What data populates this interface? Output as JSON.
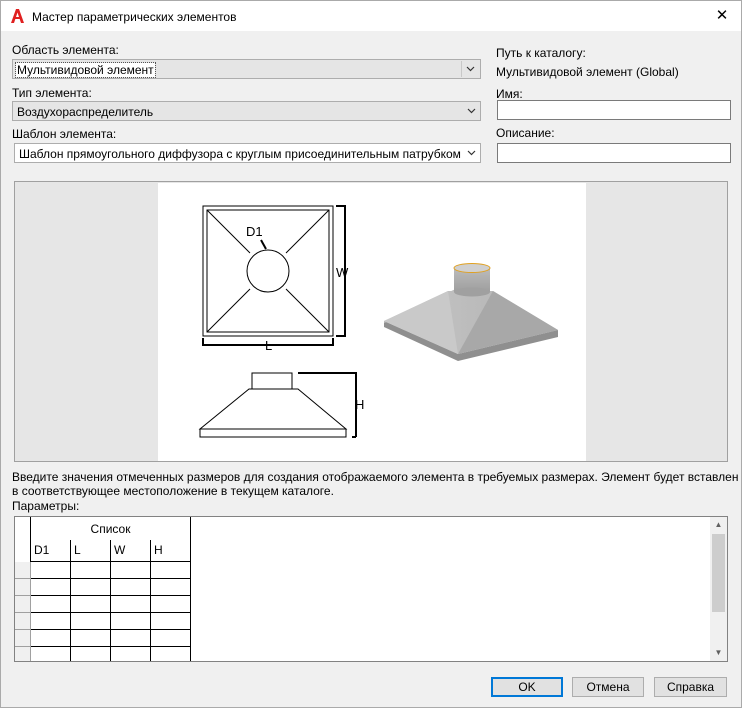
{
  "window": {
    "title": "Мастер параметрических элементов",
    "close_glyph": "✕",
    "icon": "autocad-a-icon"
  },
  "left": {
    "area_label": "Область элемента:",
    "area_value": "Мультивидовой элемент",
    "type_label": "Тип элемента:",
    "type_value": "Воздухораспределитель",
    "template_label": "Шаблон элемента:",
    "template_value": "Шаблон прямоугольного диффузора с круглым присоединительным патрубком"
  },
  "right": {
    "catalog_path_label": "Путь к каталогу:",
    "catalog_path_value": "Мультивидовой элемент (Global)",
    "name_label": "Имя:",
    "name_value": "",
    "description_label": "Описание:",
    "description_value": ""
  },
  "preview": {
    "dim_d1": "D1",
    "dim_w": "W",
    "dim_l": "L",
    "dim_h": "H"
  },
  "instructions_line1": "Введите значения отмеченных размеров для создания отображаемого элемента в требуемых размерах. Элемент будет вставлен",
  "instructions_line2": "в соответствующее местоположение в текущем каталоге.",
  "params": {
    "label": "Параметры:",
    "group_header": "Список",
    "columns": [
      "D1",
      "L",
      "W",
      "H"
    ],
    "rows": [
      [
        "",
        "",
        "",
        ""
      ],
      [
        "",
        "",
        "",
        ""
      ],
      [
        "",
        "",
        "",
        ""
      ],
      [
        "",
        "",
        "",
        ""
      ],
      [
        "",
        "",
        "",
        ""
      ],
      [
        "",
        "",
        "",
        ""
      ]
    ]
  },
  "buttons": {
    "ok": "OK",
    "cancel": "Отмена",
    "help": "Справка"
  },
  "colors": {
    "accent": "#0078d7",
    "icon_red": "#e02020"
  }
}
